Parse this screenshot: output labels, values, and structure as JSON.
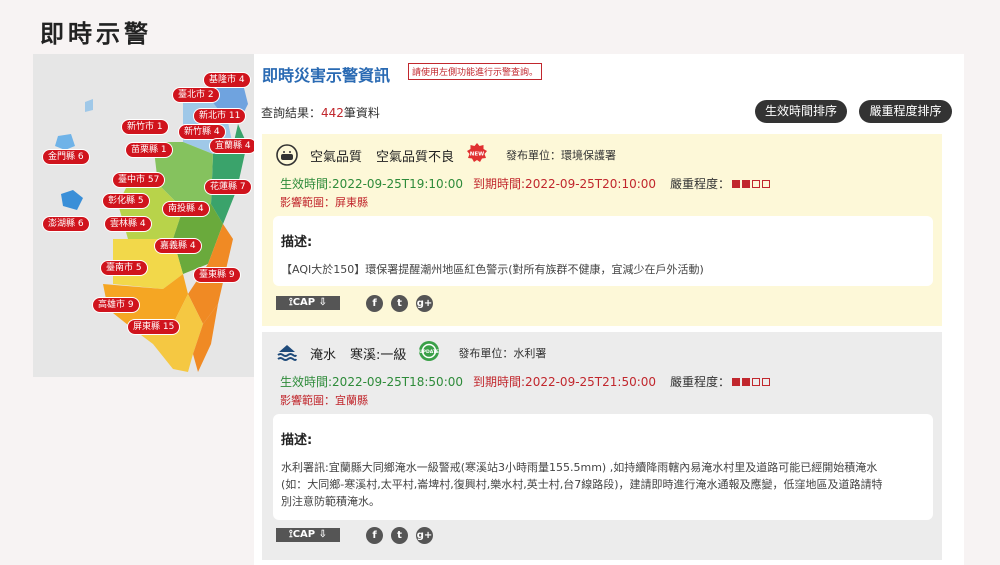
{
  "page": {
    "title": "即時示警"
  },
  "map": {
    "counties": [
      {
        "name": "基隆市 4"
      },
      {
        "name": "臺北市 2"
      },
      {
        "name": "新北市 11"
      },
      {
        "name": "新竹市 1"
      },
      {
        "name": "新竹縣 4"
      },
      {
        "name": "宜蘭縣 4"
      },
      {
        "name": "苗栗縣 1"
      },
      {
        "name": "金門縣 6"
      },
      {
        "name": "臺中市 57"
      },
      {
        "name": "花蓮縣 7"
      },
      {
        "name": "彰化縣 5"
      },
      {
        "name": "南投縣 4"
      },
      {
        "name": "澎湖縣 6"
      },
      {
        "name": "雲林縣 4"
      },
      {
        "name": "嘉義縣 4"
      },
      {
        "name": "臺南市 5"
      },
      {
        "name": "臺東縣 9"
      },
      {
        "name": "高雄市 9"
      },
      {
        "name": "屏東縣 15"
      }
    ]
  },
  "content": {
    "title": "即時災害示警資訊",
    "hint": "請使用左側功能進行示警查詢。",
    "result_label": "查詢結果：",
    "result_count": "442",
    "result_suffix": "筆資料",
    "sort_time": "生效時間排序",
    "sort_severity": "嚴重程度排序"
  },
  "alerts": [
    {
      "icon": "face-mask-icon",
      "category": "空氣品質",
      "level": "空氣品質不良",
      "badge": "NEW",
      "unit": "發布單位：環境保護署",
      "effective": "生效時間:2022-09-25T19:10:00",
      "expires": "到期時間:2022-09-25T20:10:00",
      "severity_label": "嚴重程度：",
      "severity": 2,
      "area": "影響範圍：屏東縣",
      "desc_title": "描述:",
      "desc_lines": [
        "【AQI大於150】環保署提醒潮州地區紅色警示(對所有族群不健康，宜減少在戶外活動)"
      ],
      "cap": "CAP"
    },
    {
      "icon": "flood-icon",
      "category": "淹水",
      "level": "寒溪:一級",
      "badge": "UPDATE",
      "unit": "發布單位：水利署",
      "effective": "生效時間:2022-09-25T18:50:00",
      "expires": "到期時間:2022-09-25T21:50:00",
      "severity_label": "嚴重程度：",
      "severity": 2,
      "area": "影響範圍：宜蘭縣",
      "desc_title": "描述:",
      "desc_lines": [
        "水利署訊:宜蘭縣大同鄉淹水一級警戒(寒溪站3小時雨量155.5mm) ,如持續降雨轄內易淹水村里及道路可能已經開始積淹水",
        "(如：大同鄉-寒溪村,太平村,崙埤村,復興村,樂水村,英士村,台7線路段)，建請即時進行淹水通報及應變，低窪地區及道路請特",
        "別注意防範積淹水。"
      ],
      "cap": "CAP"
    }
  ],
  "colors": {
    "accent_blue": "#2a6ab3",
    "alert_red": "#c1272d",
    "effective_green": "#2e8b3a"
  }
}
